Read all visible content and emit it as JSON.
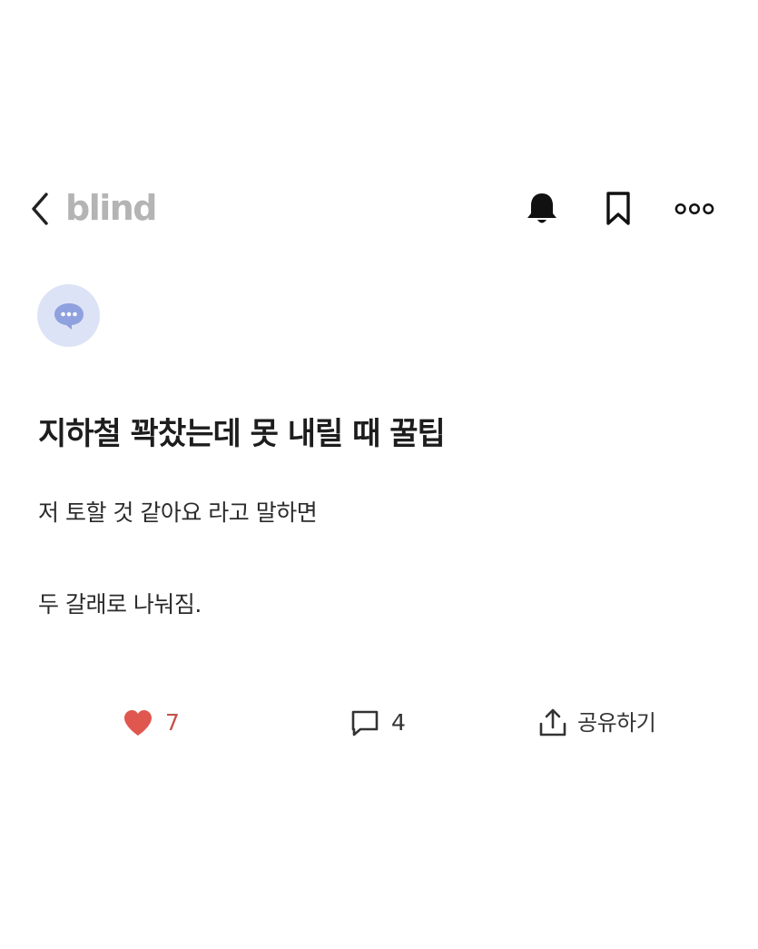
{
  "app": {
    "brand": "blind"
  },
  "header": {
    "back_icon": "chevron-left-icon",
    "actions": [
      {
        "name": "notification",
        "icon": "bell-icon"
      },
      {
        "name": "bookmark",
        "icon": "bookmark-icon"
      },
      {
        "name": "more",
        "icon": "more-horizontal-icon"
      }
    ]
  },
  "post": {
    "author_avatar_icon": "chat-bubble-icon",
    "title": "지하철 꽉찼는데 못 내릴 때 꿀팁",
    "body": [
      "저 토할 것 같아요 라고 말하면",
      "두 갈래로 나눠짐."
    ]
  },
  "reactions": {
    "likes": "7",
    "comments": "4",
    "share_label": "공유하기"
  },
  "colors": {
    "brand_text": "#b4b4b4",
    "like_red": "#e0574f",
    "avatar_bg": "#dde3f6",
    "avatar_bubble": "#8fa1de"
  }
}
